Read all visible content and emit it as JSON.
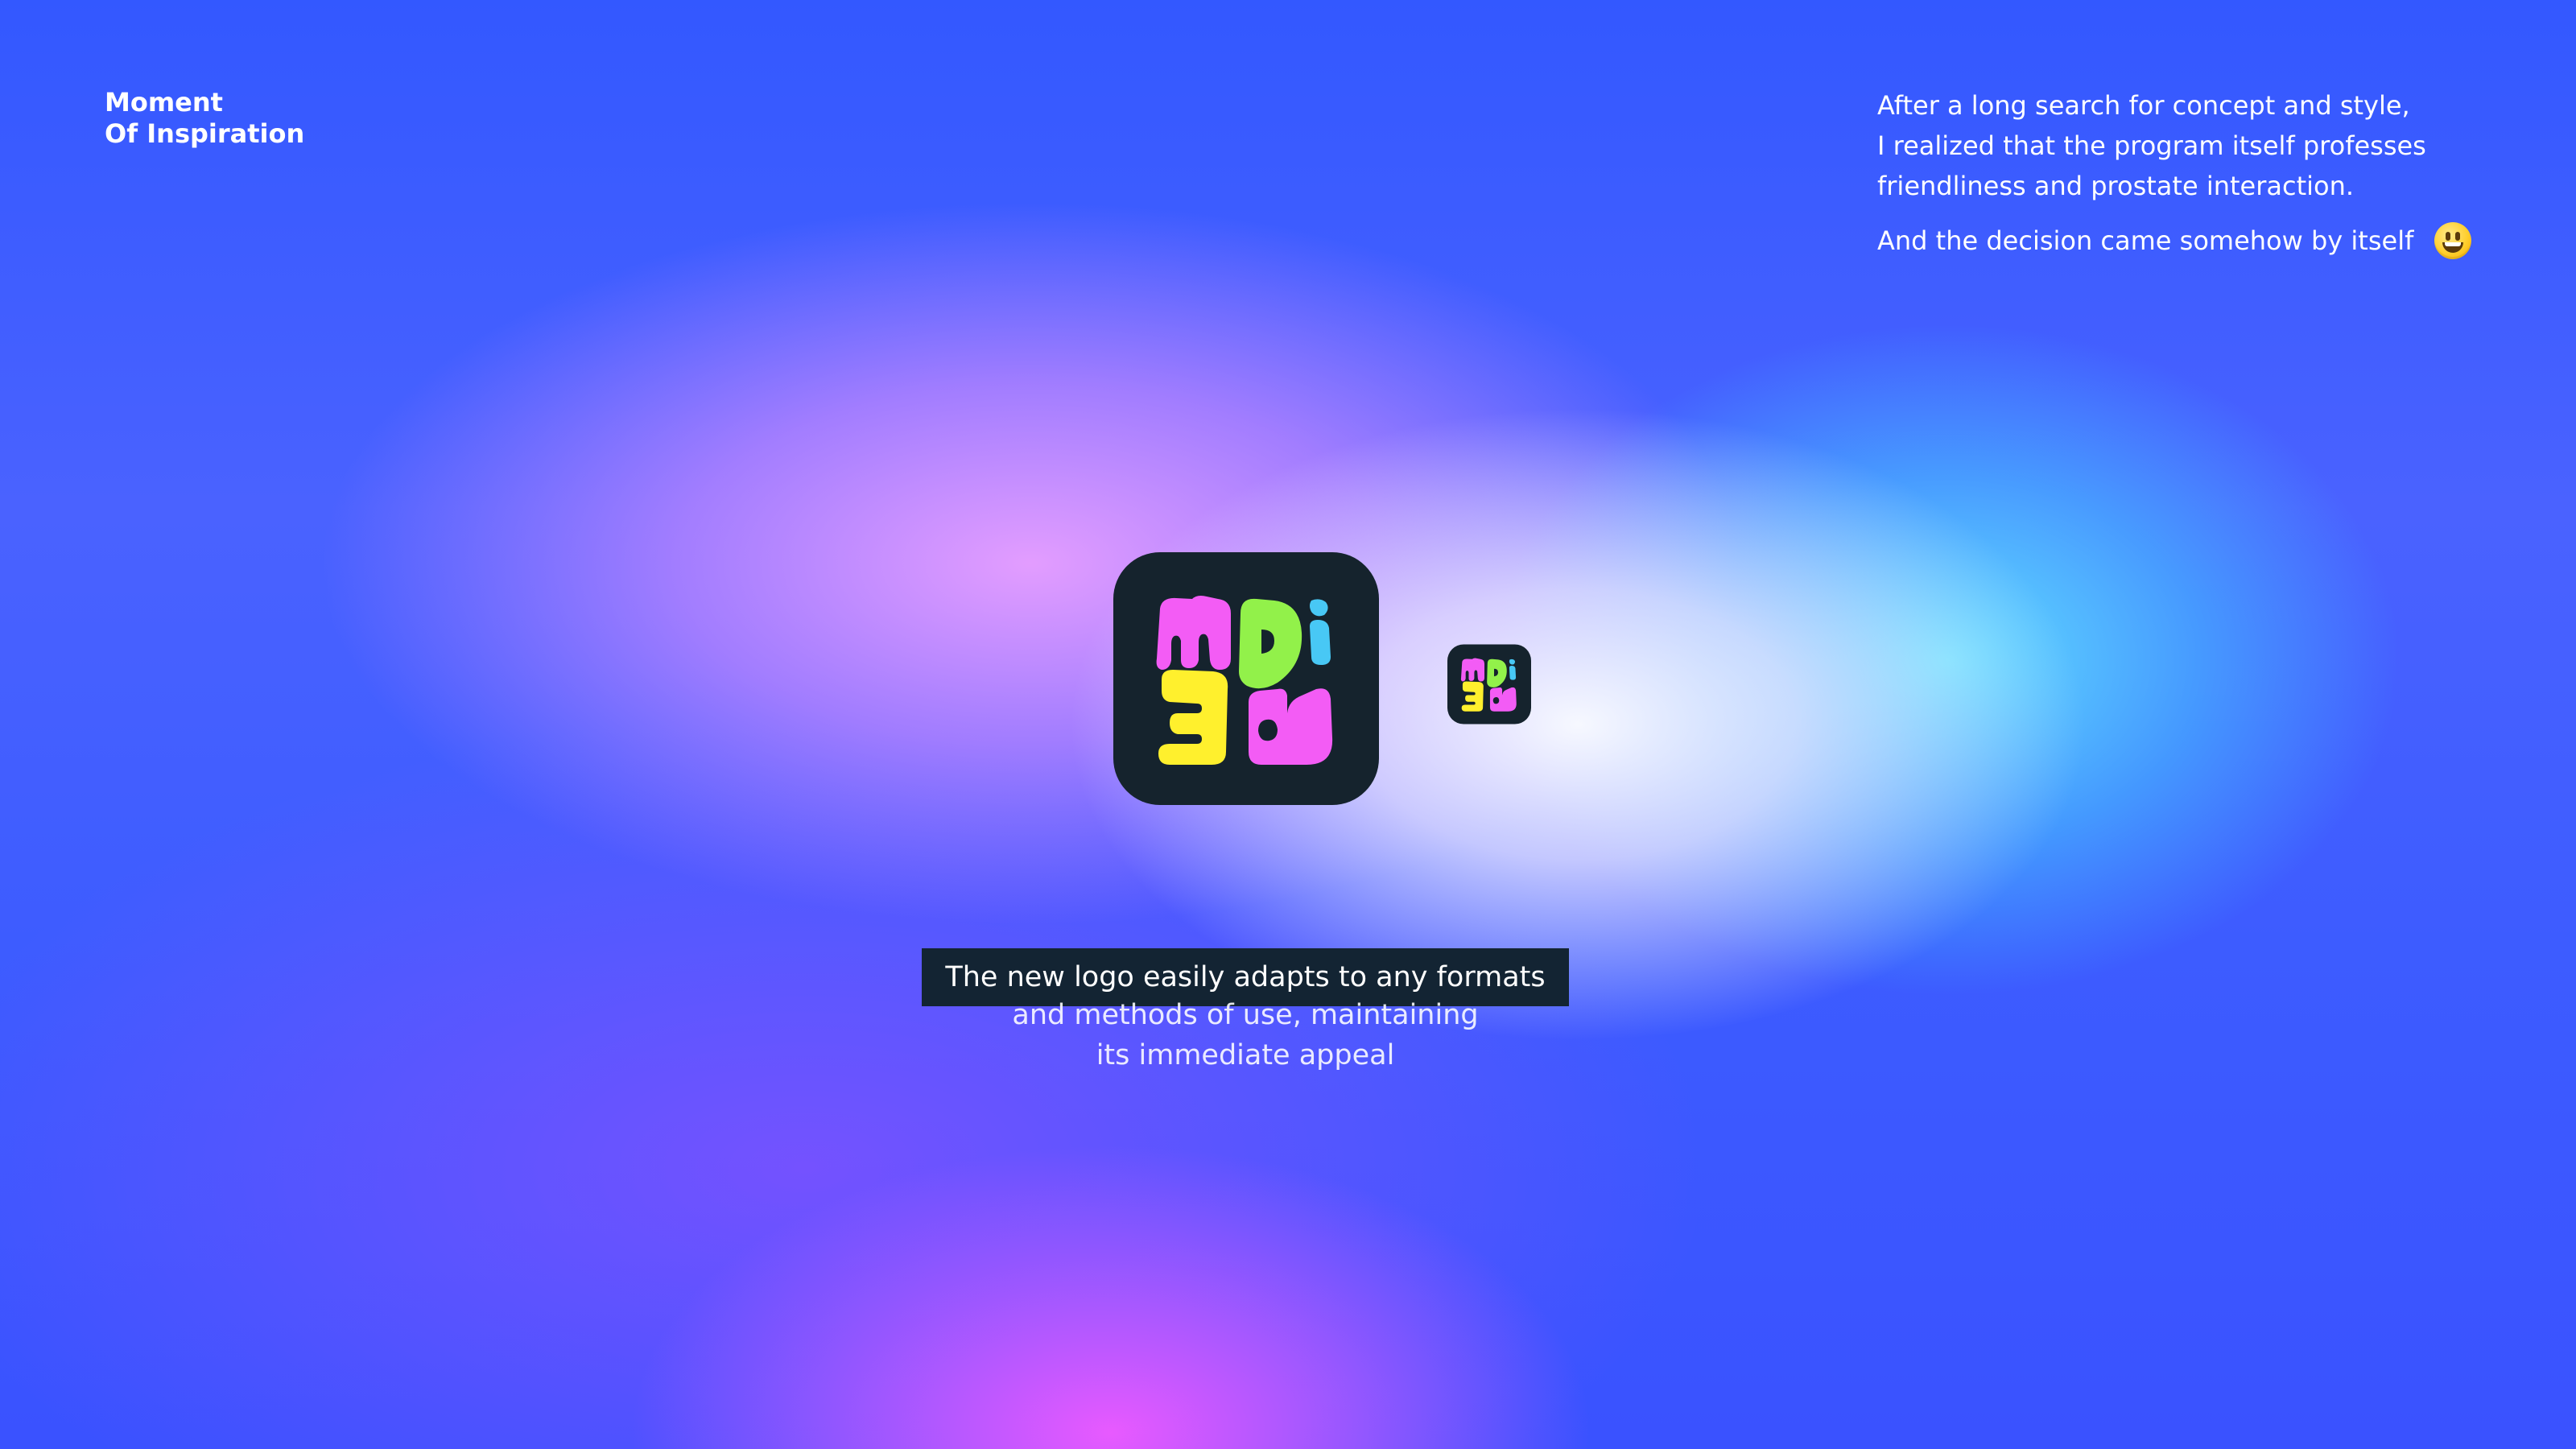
{
  "header": {
    "title_line1": "Moment",
    "title_line2": "Of Inspiration"
  },
  "intro": {
    "lines": [
      "After a long search for concept and style,",
      "I realized that the program itself professes",
      "friendliness and prostate interaction."
    ],
    "decision": "And the decision came somehow by itself",
    "emoji": "smiling-face-icon"
  },
  "logo": {
    "text_top": "mDi",
    "text_bottom": "3D",
    "colors": {
      "tile": "#15232d",
      "magenta": "#f35cf5",
      "green": "#92f14a",
      "cyan": "#48c8f5",
      "yellow": "#fff02d"
    }
  },
  "caption": {
    "highlight": "The new logo easily adapts to any formats",
    "line2": "and methods of use, maintaining",
    "line3": "its immediate appeal"
  }
}
